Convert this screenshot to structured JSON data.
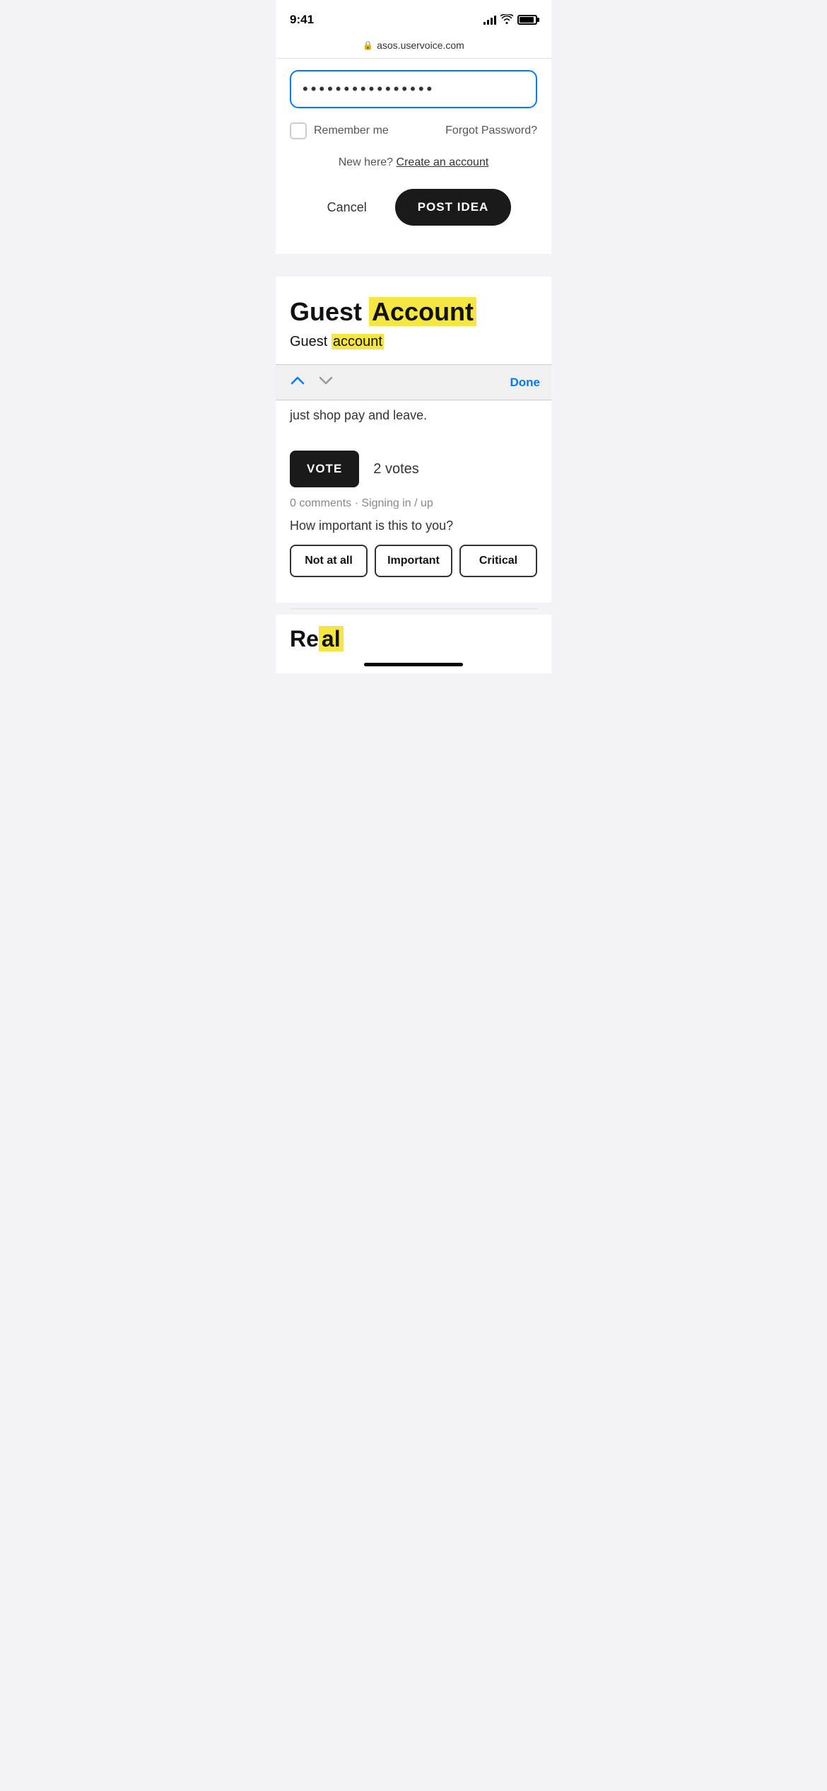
{
  "statusBar": {
    "time": "9:41",
    "url": "asos.uservoice.com"
  },
  "passwordSection": {
    "passwordValue": "••••••••••••••••",
    "rememberLabel": "Remember me",
    "forgotLabel": "Forgot Password?",
    "newHereText": "New here?",
    "createAccountLink": "Create an account",
    "cancelLabel": "Cancel",
    "postIdeaLabel": "POST IDEA"
  },
  "findToolbar": {
    "upArrow": "▲",
    "downArrow": "▼",
    "doneLabel": "Done"
  },
  "contentSection": {
    "titleStart": "Guest ",
    "titleHighlight": "Account",
    "subtitleStart": "Guest ",
    "subtitleHighlight": "account",
    "bodyText": "just shop pay and leave.",
    "voteLabel": "VOTE",
    "voteCount": "2 votes",
    "commentsText": "0 comments",
    "metaSeparator": "·",
    "signingText": "Signing in / up",
    "importanceQuestion": "How important is this to you?",
    "importanceOptions": [
      "Not at all",
      "Important",
      "Critical"
    ]
  },
  "bottomSection": {
    "titleStart": "Re",
    "titleHighlight": "al"
  }
}
